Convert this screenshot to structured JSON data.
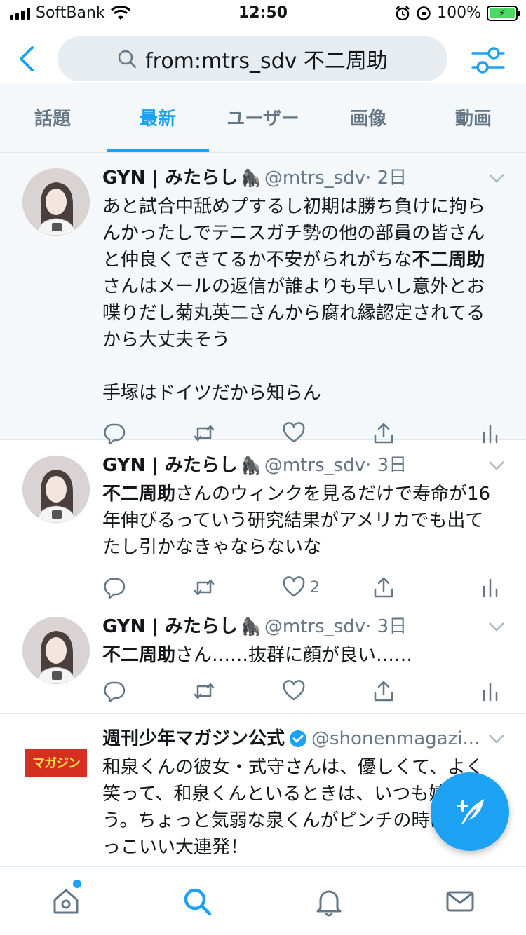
{
  "status_bar": {
    "carrier": "SoftBank",
    "time": "12:50",
    "battery": "100%"
  },
  "search": {
    "query": "from:mtrs_sdv 不二周助"
  },
  "tabs": [
    {
      "label": "話題",
      "active": false
    },
    {
      "label": "最新",
      "active": true
    },
    {
      "label": "ユーザー",
      "active": false
    },
    {
      "label": "画像",
      "active": false
    },
    {
      "label": "動画",
      "active": false
    }
  ],
  "tweets": [
    {
      "name": "GYN | みたらし",
      "emoji": "🦍",
      "handle": "@mtrs_sdv",
      "time": "· 2日",
      "before": "あと試合中舐めプするし初期は勝ち負けに拘らんかったしでテニスガチ勢の他の部員の皆さんと仲良くできてるか不安がられがちな",
      "bold": "不二周助",
      "after": "さんはメールの返信が誰よりも早いし意外とお喋りだし菊丸英二さんから腐れ縁認定されてるから大丈夫そう\n\n手塚はドイツだから知らん",
      "likes": ""
    },
    {
      "name": "GYN | みたらし",
      "emoji": "🦍",
      "handle": "@mtrs_sdv",
      "time": "· 3日",
      "before": "",
      "bold": "不二周助",
      "after": "さんのウィンクを見るだけで寿命が16年伸びるっていう研究結果がアメリカでも出てたし引かなきゃならないな",
      "likes": "2"
    },
    {
      "name": "GYN | みたらし",
      "emoji": "🦍",
      "handle": "@mtrs_sdv",
      "time": "· 3日",
      "before": "",
      "bold": "不二周助",
      "after": "さん……抜群に顔が良い……",
      "likes": ""
    },
    {
      "name": "週刊少年マガジン公式",
      "handle": "@shonenmagazi...",
      "logo": "マガジン",
      "text": "和泉くんの彼女・式守さんは、優しくて、よく笑って、和泉くんといるときは、いつも嬉しそう。ちょっと気弱な泉くんがピンチの時は、かっこいい大連発！"
    }
  ],
  "icons": {
    "back": "chevron-left-icon",
    "filter": "sliders-icon",
    "reply": "reply-icon",
    "retweet": "retweet-icon",
    "like": "heart-icon",
    "share": "share-icon",
    "stats": "stats-icon",
    "compose": "compose-tweet-icon"
  },
  "colors": {
    "accent": "#1da1f2",
    "secondary_text": "#657786",
    "background_gray": "#f5f8fa"
  }
}
